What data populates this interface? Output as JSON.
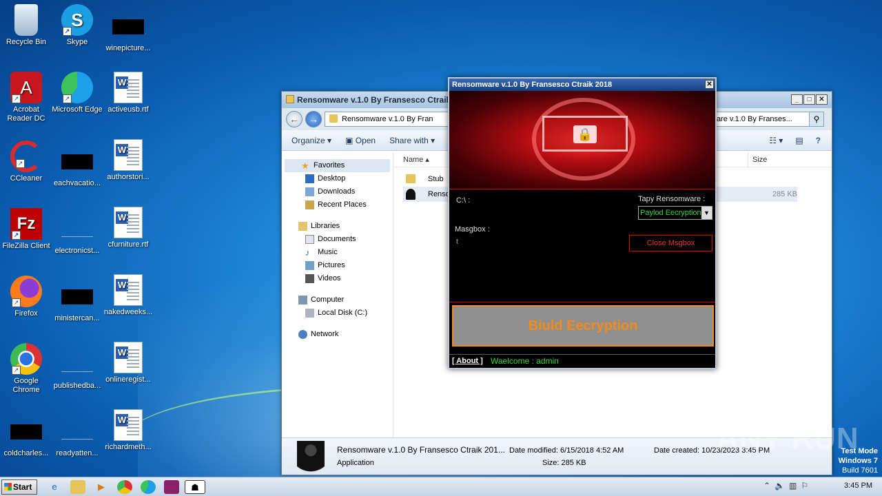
{
  "desktop": {
    "icons": [
      {
        "label": "Recycle Bin"
      },
      {
        "label": "Skype"
      },
      {
        "label": "winepicture..."
      },
      {
        "label": "Acrobat Reader DC"
      },
      {
        "label": "Microsoft Edge"
      },
      {
        "label": "activeusb.rtf"
      },
      {
        "label": "CCleaner"
      },
      {
        "label": "eachvacatio..."
      },
      {
        "label": "authorstori..."
      },
      {
        "label": "FileZilla Client"
      },
      {
        "label": "electronicst..."
      },
      {
        "label": "cfurniture.rtf"
      },
      {
        "label": "Firefox"
      },
      {
        "label": "ministercan..."
      },
      {
        "label": "nakedweeks..."
      },
      {
        "label": "Google Chrome"
      },
      {
        "label": "publishedba..."
      },
      {
        "label": "onlineregist..."
      },
      {
        "label": "coldcharles..."
      },
      {
        "label": "readyatten..."
      },
      {
        "label": "richardmeth..."
      }
    ]
  },
  "explorer": {
    "title": "Rensomware v.1.0 By Fransesco Ctraik",
    "address": "Rensomware v.1.0 By Fran",
    "search": "ware v.1.0 By Franses...",
    "toolbar": {
      "organize": "Organize",
      "open": "Open",
      "share": "Share with"
    },
    "nav": {
      "favorites": "Favorites",
      "desktop": "Desktop",
      "downloads": "Downloads",
      "recent": "Recent Places",
      "libraries": "Libraries",
      "documents": "Documents",
      "music": "Music",
      "pictures": "Pictures",
      "videos": "Videos",
      "computer": "Computer",
      "localdisk": "Local Disk (C:)",
      "network": "Network"
    },
    "columns": {
      "name": "Name",
      "size": "Size"
    },
    "files": [
      {
        "name": "Stub",
        "size": ""
      },
      {
        "name": "Rensomw",
        "size": "285 KB"
      }
    ],
    "status": {
      "filename": "Rensomware v.1.0 By Fransesco Ctraik 201...",
      "type": "Application",
      "modified": "Date modified: 6/15/2018 4:52 AM",
      "size": "Size: 285 KB",
      "created": "Date created: 10/23/2023 3:45 PM"
    }
  },
  "app": {
    "title": "Rensomware v.1.0 By Fransesco Ctraik 2018",
    "path": "C:\\ :",
    "type_label": "Tapy Rensomware :",
    "type_value": "Paylod Eecryption",
    "msgbox_label": "Masgbox :",
    "msgbox_value": "t",
    "close_msgbox": "Close Msgbox",
    "build": "Biuld Eecryption",
    "about": "[ About ]",
    "welcome": "Waelcome : admin"
  },
  "watermark": "ANY RUN",
  "testmode": {
    "line1": "Test Mode",
    "line2": "Windows 7",
    "line3": "Build 7601"
  },
  "taskbar": {
    "start": "Start",
    "clock": "3:45 PM"
  }
}
